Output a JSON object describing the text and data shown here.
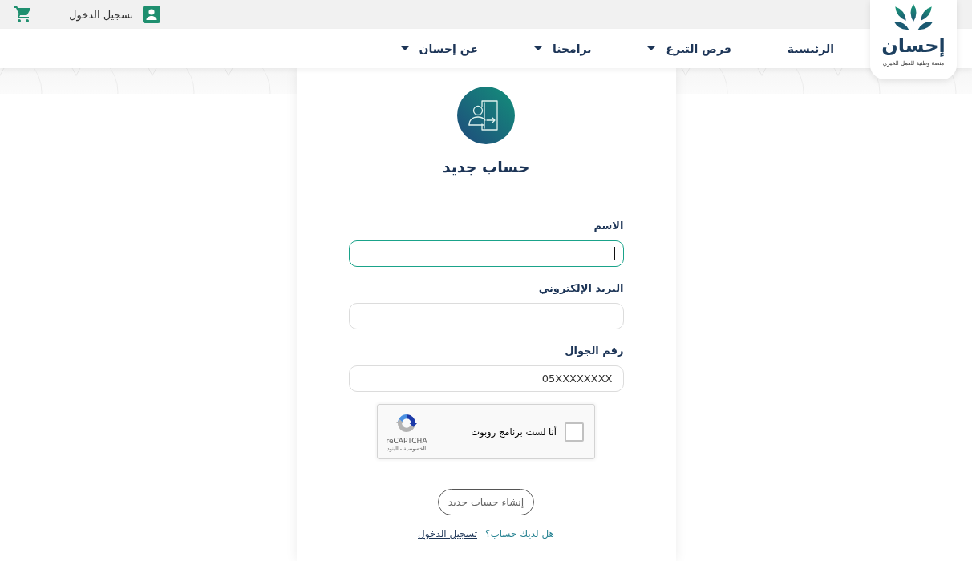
{
  "top_bar": {
    "login_link": "تسجيل الدخول"
  },
  "logo": {
    "name": "إحسان",
    "tagline": "منصة وطنية للعمل الخيري"
  },
  "nav": {
    "items": [
      {
        "label": "الرئيسية",
        "has_menu": false
      },
      {
        "label": "فرص التبرع",
        "has_menu": true
      },
      {
        "label": "برامجنا",
        "has_menu": true
      },
      {
        "label": "عن إحسان",
        "has_menu": true
      }
    ]
  },
  "form": {
    "title": "حساب جديد",
    "fields": [
      {
        "label": "الاسم",
        "focused": true
      },
      {
        "label": "البريد الإلكتروني",
        "focused": false
      },
      {
        "label": "رقم الجوال",
        "placeholder": "05XXXXXXXX",
        "focused": false
      }
    ],
    "captcha": {
      "label": "أنا لست برنامج روبوت",
      "checked": false,
      "brand": "reCAPTCHA",
      "terms": "الخصوصية - البنود"
    },
    "submit_button": "إنشاء حساب جديد",
    "login_prompt": {
      "question": "هل لديك حساب؟",
      "link": "تسجيل الدخول"
    }
  }
}
